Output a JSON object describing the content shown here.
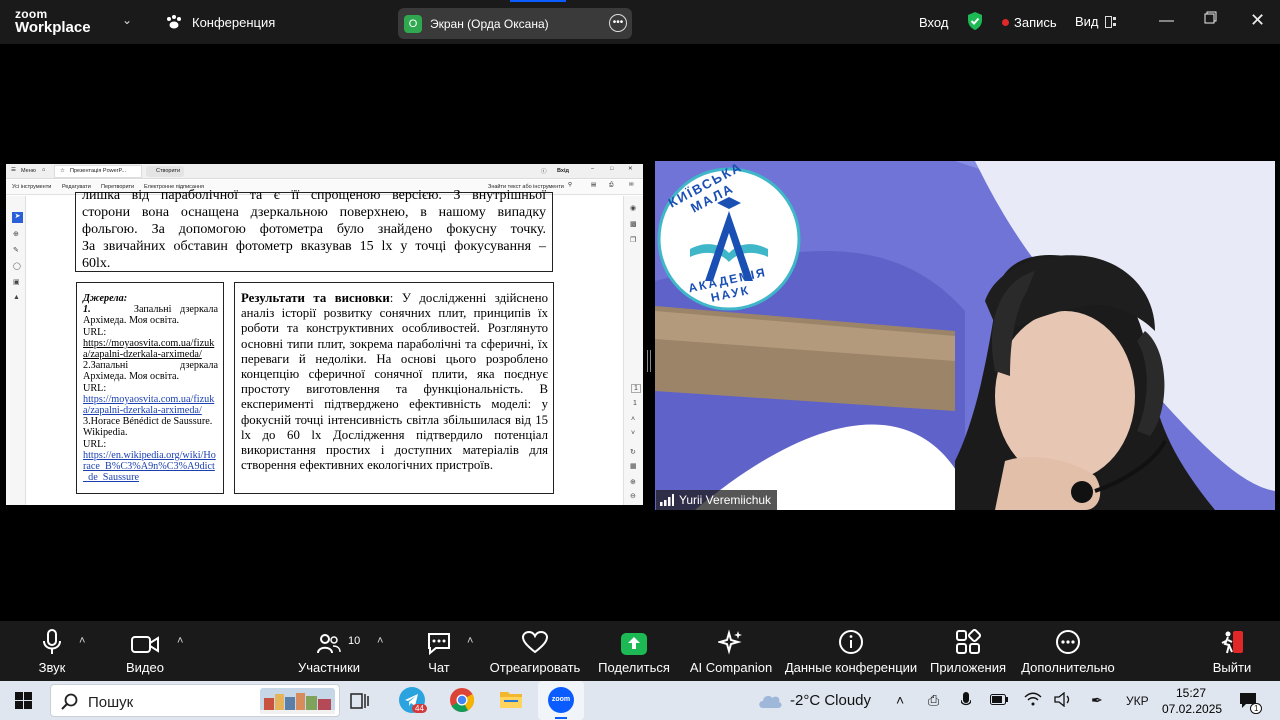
{
  "topbar": {
    "brand_line1": "zoom",
    "brand_line2": "Workplace",
    "conference": "Конференция",
    "screen_share_label": "Экран (Орда Оксана)",
    "screen_share_avatar": "О",
    "signin": "Вход",
    "record": "Запись",
    "view": "Вид",
    "icons": [
      "chevron-down-icon",
      "paw-icon",
      "more-icon",
      "shield-check-icon",
      "record-dot-icon",
      "view-grid-icon",
      "minimize-icon",
      "restore-icon",
      "close-icon"
    ],
    "colors": {
      "shield": "#1db954",
      "record": "#e02828",
      "avatar": "#2fa84f",
      "active_tab": "#0b5cff"
    }
  },
  "shared_doc": {
    "tabs": {
      "menu": "Меню",
      "home_tab": "Презентація PowerP...",
      "new_tab": "Створити",
      "signin": "Вхід"
    },
    "tools": {
      "all_tools": "Усі інструменти",
      "edit": "Редагувати",
      "convert": "Перетворити",
      "esign": "Електронне підписання",
      "find": "Знайти текст або інструменти"
    },
    "page_nav": [
      "1",
      "1"
    ],
    "top_text_lines": [
      "лишка від параболічної та є її спрощеною версією. З внутрішньої",
      "сторони вона оснащена дзеркальною поверхнею, в нашому випадку",
      "фольгою. За допомогою фотометра було знайдено фокусну точку.",
      "За звичайних обставин фотометр вказував 15 lx у точці фокусування –",
      "60lx."
    ],
    "sources": {
      "title": "Джерела:",
      "item1_num": "1.",
      "item1_text_a": "Запальні дзеркала",
      "item1_text_b": "Архімеда. Моя освіта.",
      "url_label": "URL:",
      "item1_link": "https://moyaosvita.com.ua/fizuka/zapalni-dzerkala-arximeda/",
      "item2_text_a": "2.Запальні дзеркала",
      "item2_text_b": "Архімеда. Моя освіта.",
      "item2_link": "https://moyaosvita.com.ua/fizuka/zapalni-dzerkala-arximeda/",
      "item3_text": "3.Horace Bénédict de Saussure. Wikipedia.",
      "item3_link": "https://en.wikipedia.org/wiki/Horace_B%C3%A9n%C3%A9dict_de_Saussure"
    },
    "results": {
      "title": "Результати та висновки",
      "text": ": У дослідженні здійснено аналіз історії розвитку сонячних плит, принципів їх роботи та конструктивних особливостей. Розглянуто основні типи плит, зокрема параболічні та сферичні, їх переваги й недоліки. На основі цього розроблено концепцію сферичної сонячної плити, яка поєднує простоту виготовлення та функціональність. В експерименті підтверджено ефективність моделі: у фокусній точці інтенсивність світла збільшилася від 15 lx до 60 lx Дослідження підтвердило потенціал використання простих і доступних матеріалів для створення ефективних екологічних пристроїв."
    }
  },
  "video": {
    "participant_name": "Yurii Veremiichuk",
    "logo_text_top": "КИЇВСЬКА МАЛА",
    "logo_text_bottom": "АКАДЕМІЯ НАУК",
    "logo_letter": "А",
    "colors": {
      "background_purple": "#6f74d6",
      "logo_blue": "#1a4fb3",
      "logo_teal": "#3fb7c9"
    }
  },
  "toolbar": {
    "audio": "Звук",
    "video": "Видео",
    "participants": "Участники",
    "participants_count": "10",
    "chat": "Чат",
    "react": "Отреагировать",
    "share": "Поделиться",
    "ai": "AI Companion",
    "info": "Данные конференции",
    "apps": "Приложения",
    "more": "Дополнительно",
    "leave": "Выйти",
    "colors": {
      "share": "#1db954",
      "leave": "#e02828"
    }
  },
  "taskbar": {
    "search": "Пошук",
    "weather": "-2°C  Cloudy",
    "lang": "УКР",
    "time": "15:27",
    "date": "07.02.2025",
    "telegram_badge": "44",
    "notif_badge": "1",
    "icons": [
      "windows-start-icon",
      "search-icon",
      "task-view-icon",
      "telegram-icon",
      "chrome-icon",
      "file-explorer-icon",
      "zoom-icon",
      "cloud-icon",
      "chevron-up-icon",
      "phone-link-icon",
      "mic-icon",
      "battery-icon",
      "wifi-icon",
      "volume-icon",
      "pen-icon",
      "notification-icon"
    ]
  }
}
